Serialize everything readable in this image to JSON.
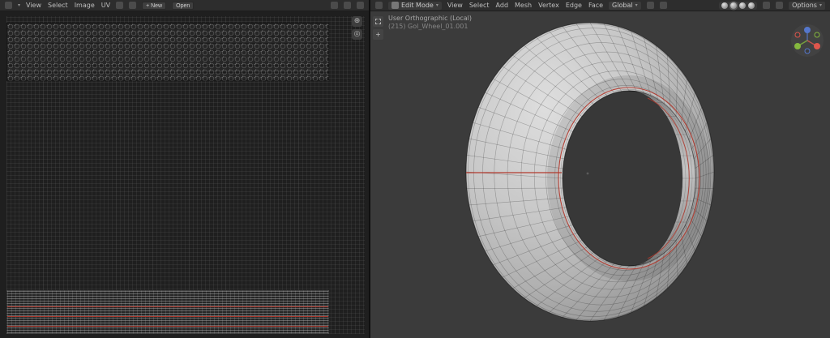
{
  "colors": {
    "header_bg": "#2d2d2d",
    "panel_bg": "#1f1f1f",
    "viewport_bg": "#3b3b3b",
    "seam_red": "#b23a2e",
    "wire": "#1e1e1e",
    "torus_light": "#dedede",
    "torus_dark": "#8a8a8a",
    "axis_x": "#e0564c",
    "axis_y": "#85b83e",
    "axis_z": "#5577cc"
  },
  "left_editor": {
    "menus": [
      "View",
      "Select",
      "Image",
      "UV"
    ],
    "new_button": "+ New",
    "open_button": "Open"
  },
  "right_editor": {
    "mode_label": "Edit Mode",
    "orientation_label": "Global",
    "options_label": "Options",
    "menus": [
      "View",
      "Select",
      "Add",
      "Mesh",
      "Vertex",
      "Edge",
      "Face"
    ],
    "overlay": {
      "line1": "User Orthographic (Local)",
      "line2": "(215) Gol_Wheel_01.001"
    }
  },
  "uv": {
    "seam_rows": [
      19,
      31,
      43
    ]
  }
}
